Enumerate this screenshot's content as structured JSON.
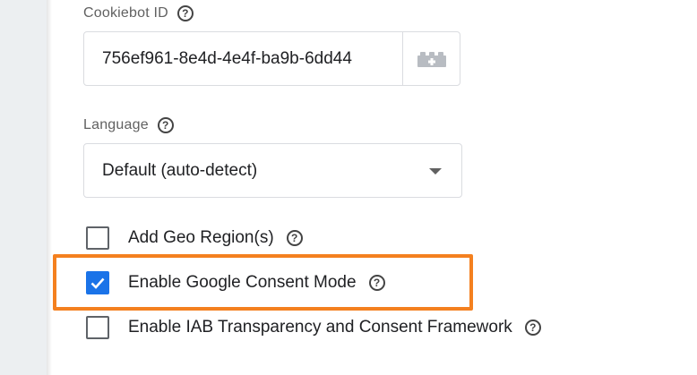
{
  "cookiebot_id": {
    "label": "Cookiebot ID",
    "value": "756ef961-8e4d-4e4f-ba9b-6dd44",
    "help_icon": "help-circle-icon",
    "variable_button_icon": "brick-plus-icon"
  },
  "language": {
    "label": "Language",
    "selected": "Default (auto-detect)",
    "help_icon": "help-circle-icon"
  },
  "options": [
    {
      "label": "Add Geo Region(s)",
      "checked": false
    },
    {
      "label": "Enable Google Consent Mode",
      "checked": true
    },
    {
      "label": "Enable IAB Transparency and Consent Framework",
      "checked": false
    }
  ],
  "colors": {
    "accent": "#1a73e8",
    "highlight": "#f4801f",
    "gutter": "#eceff1"
  }
}
